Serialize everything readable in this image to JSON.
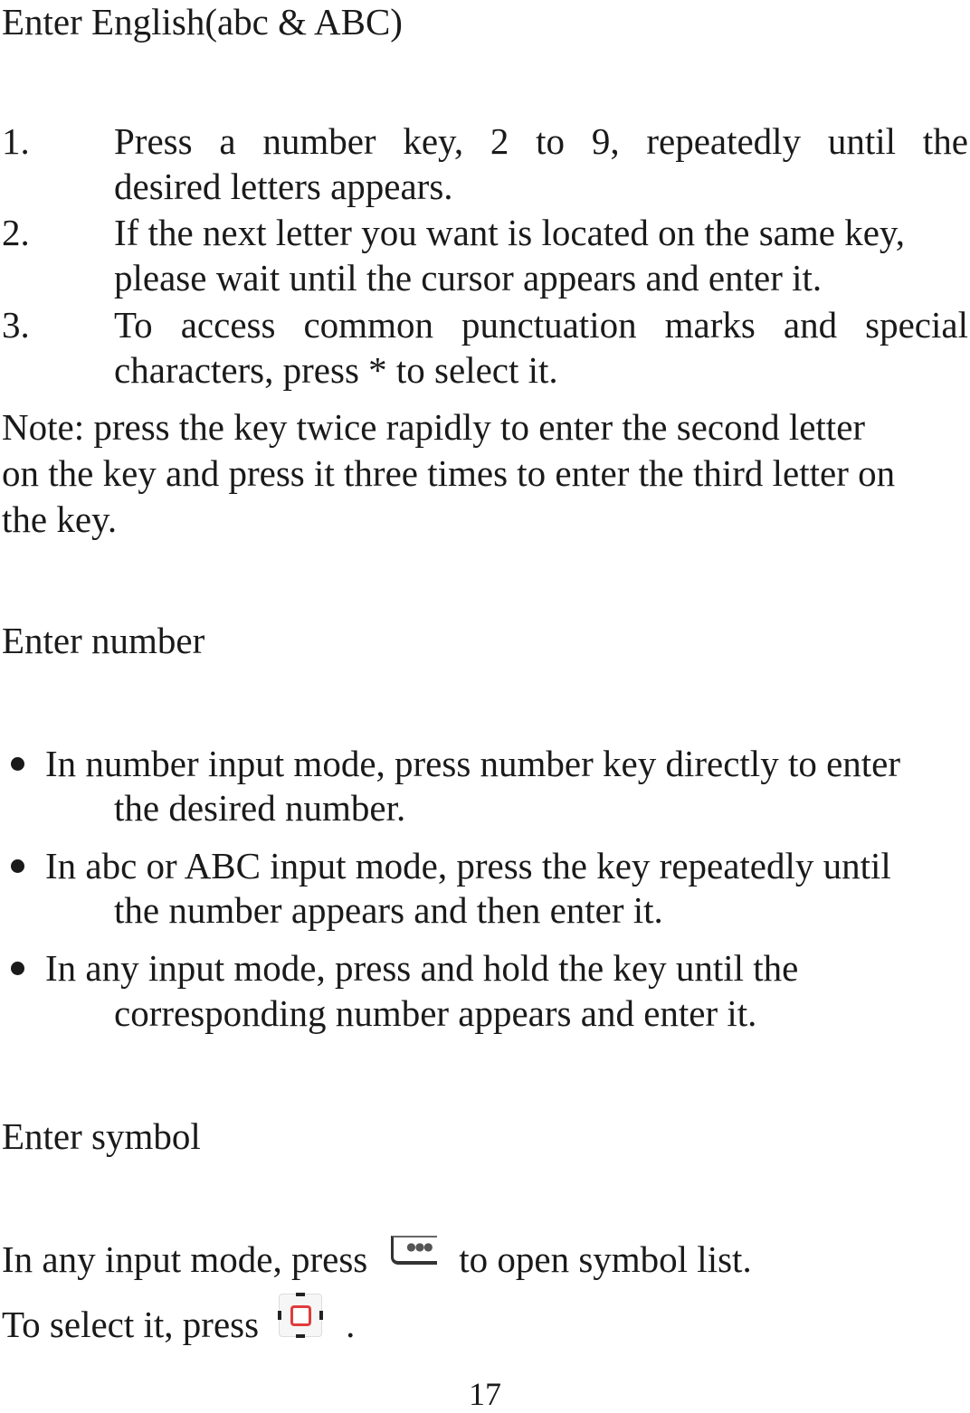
{
  "sections": {
    "english": {
      "heading": "Enter English(abc & ABC)",
      "steps": [
        {
          "num": "1.",
          "line1_words": [
            "Press",
            "a",
            "number",
            "key,",
            "2",
            "to",
            "9,",
            "repeatedly",
            "until",
            "the"
          ],
          "line2": "desired letters appears."
        },
        {
          "num": "2.",
          "line1": "If the next letter you want is located on the same key,",
          "line2": "please wait until the cursor appears and enter it."
        },
        {
          "num": "3.",
          "line1_words": [
            "To",
            "access",
            "common",
            "punctuation",
            "marks",
            "and",
            "special"
          ],
          "line2": "characters, press * to select it."
        }
      ],
      "note_lines": [
        "Note: press the key twice rapidly to enter the second letter",
        "on the key and press it three times to enter the third letter on",
        "the key."
      ]
    },
    "number": {
      "heading": "Enter number",
      "bullets": [
        {
          "line1": "In number input mode, press number key directly to enter",
          "line2": "the desired number."
        },
        {
          "line1": "In abc or ABC input mode, press the key repeatedly until",
          "line2": "the number appears and then enter it."
        },
        {
          "line1": "In any input mode, press and hold the key until the",
          "line2": "corresponding number appears and enter it."
        }
      ]
    },
    "symbol": {
      "heading": "Enter symbol",
      "line1_before": "In any input mode, press",
      "line1_icon": "symbol-key-icon",
      "line1_after": "to open symbol list.",
      "line2_before": "To select it, press",
      "line2_icon": "ok-key-icon",
      "line2_after": "."
    }
  },
  "page_number": "17"
}
